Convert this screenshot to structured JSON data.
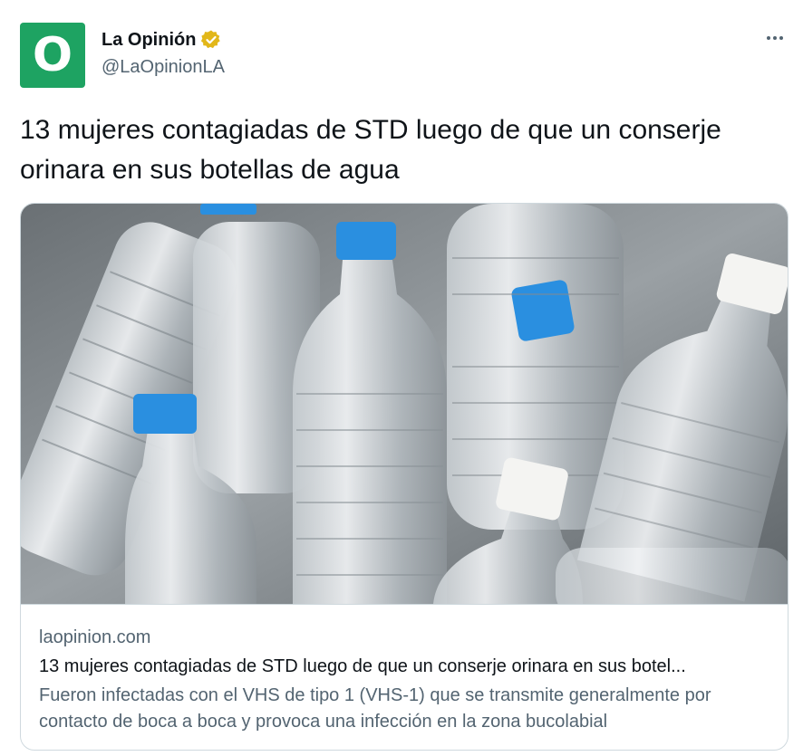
{
  "author": {
    "display_name": "La Opinión",
    "handle": "@LaOpinionLA",
    "avatar_letter": "O",
    "avatar_color": "#1ea362",
    "verified_badge": "gold-verified-badge-icon"
  },
  "tweet": {
    "text": "13 mujeres contagiadas de STD luego de que un conserje orinara en sus botellas de agua"
  },
  "menu": {
    "icon": "more-options-icon"
  },
  "card": {
    "image_subject": "plastic-water-bottles-photo",
    "domain": "laopinion.com",
    "title": "13 mujeres contagiadas de STD luego de que un conserje orinara en sus botel...",
    "description": "Fueron infectadas con el VHS de tipo 1 (VHS-1) que se transmite generalmente por contacto de boca a boca y provoca una infección en la zona bucolabial"
  },
  "colors": {
    "text": "#0f1419",
    "secondary": "#536471",
    "border": "#cfd9de",
    "verified_gold": "#e2b719",
    "bottle_cap_blue": "#2a8fe0"
  }
}
